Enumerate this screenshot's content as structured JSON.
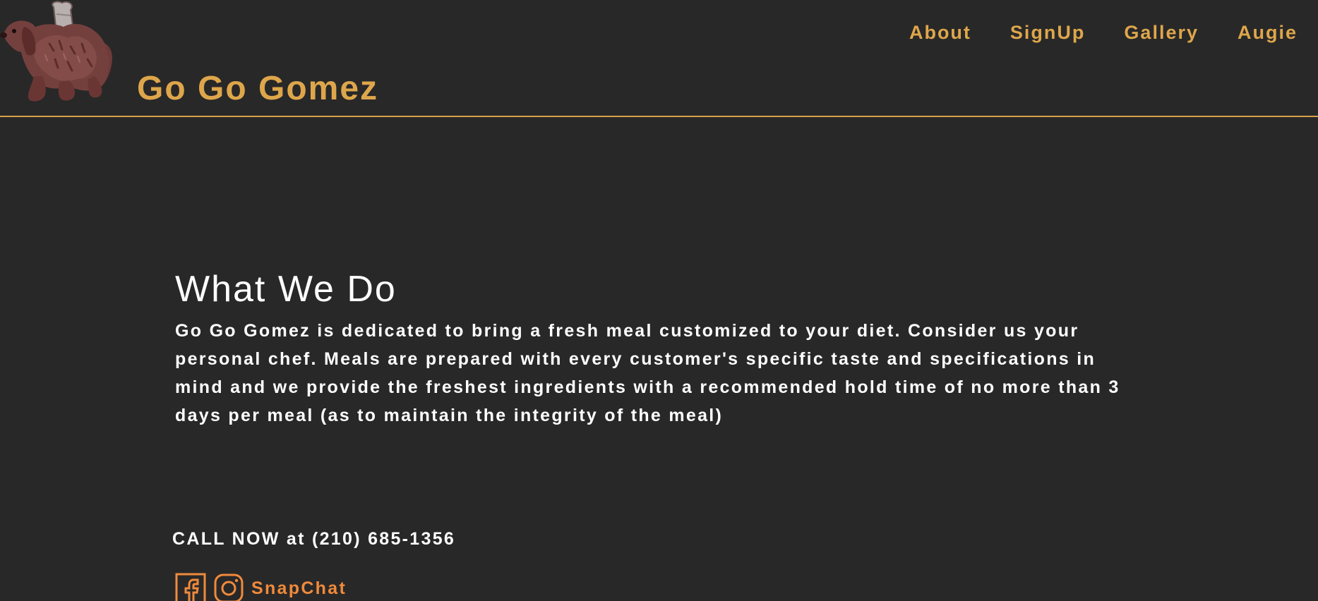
{
  "header": {
    "site_title": "Go Go Gomez",
    "logo_icon": "dog-chef-mascot-icon",
    "nav": [
      {
        "label": "About"
      },
      {
        "label": "SignUp"
      },
      {
        "label": "Gallery"
      },
      {
        "label": "Augie"
      }
    ]
  },
  "main": {
    "heading": "What We Do",
    "body": "Go Go Gomez is dedicated to bring a fresh meal customized to your diet. Consider us your personal chef. Meals are prepared with every customer's specific taste and specifications in mind and we provide the freshest ingredients with a recommended hold time of no more than 3 days per meal (as to maintain the integrity of the meal)"
  },
  "contact": {
    "cta": "CALL NOW at (210) 685-1356"
  },
  "social": {
    "facebook_icon": "facebook-icon",
    "instagram_icon": "instagram-icon",
    "snapchat_label": "SnapChat"
  },
  "colors": {
    "background": "#282828",
    "accent": "#dea64b",
    "divider": "#d9a04a",
    "text": "#ffffff",
    "social": "#f08a3c"
  }
}
